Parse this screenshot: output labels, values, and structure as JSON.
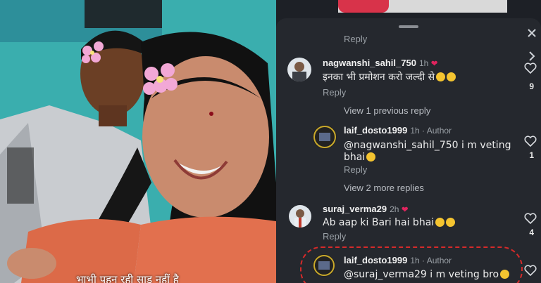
{
  "caption": "भाभी पहन रही साड़ नहीं है",
  "comments_panel": {
    "top_reply_label": "Reply",
    "comments": [
      {
        "username": "nagwanshi_sahil_750",
        "time": "1h",
        "text": "इनका भी प्रमोशन करो जल्दी से",
        "reply_label": "Reply",
        "likes": "9"
      },
      {
        "username": "laif_dosto1999",
        "time": "1h",
        "author_badge": "Author",
        "text_line1": "@nagwanshi_sahil_750 i m veting",
        "text_line2": "bhai",
        "reply_label": "Reply",
        "likes": "1"
      },
      {
        "username": "suraj_verma29",
        "time": "2h",
        "text": "Ab aap ki Bari hai bhai",
        "reply_label": "Reply",
        "likes": "4"
      },
      {
        "username": "laif_dosto1999",
        "time": "1h",
        "author_badge": "Author",
        "text": "@suraj_verma29 i m veting bro"
      }
    ],
    "view_previous": "View 1 previous reply",
    "view_more": "View 2 more replies"
  },
  "colors": {
    "panel_bg": "#25282e",
    "highlight": "#d62a2a",
    "like_red": "#e0245e"
  }
}
